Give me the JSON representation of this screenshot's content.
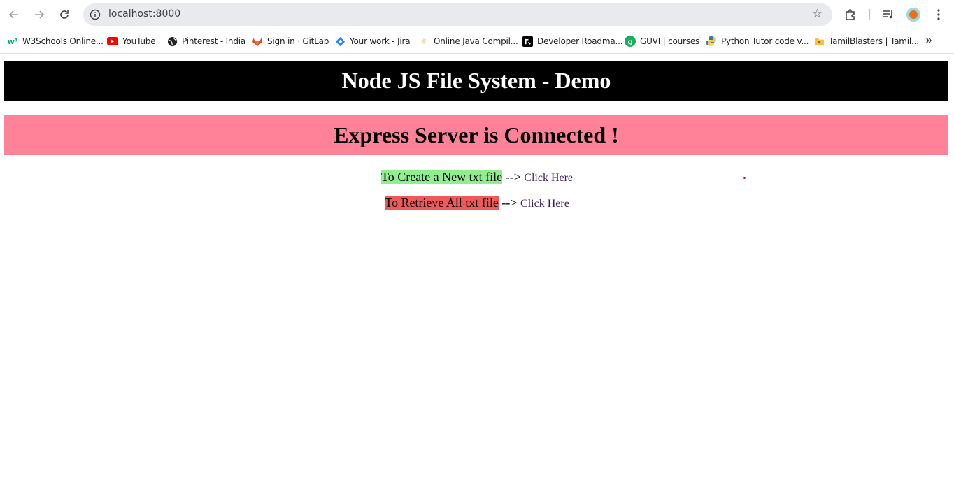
{
  "browser": {
    "url": "localhost:8000",
    "bookmarks": [
      {
        "label": "W3Schools Online...",
        "icon": "w3schools-icon"
      },
      {
        "label": "YouTube",
        "icon": "youtube-icon"
      },
      {
        "label": "Pinterest - India",
        "icon": "globe-icon"
      },
      {
        "label": "Sign in · GitLab",
        "icon": "gitlab-icon"
      },
      {
        "label": "Your work - Jira",
        "icon": "jira-icon"
      },
      {
        "label": "Online Java Compil...",
        "icon": "sun-icon"
      },
      {
        "label": "Developer Roadma...",
        "icon": "roadmap-icon"
      },
      {
        "label": "GUVI | courses",
        "icon": "guvi-icon"
      },
      {
        "label": "Python Tutor code v...",
        "icon": "python-icon"
      },
      {
        "label": "TamilBlasters | Tamil...",
        "icon": "folder-icon"
      }
    ],
    "more_bookmarks": "»"
  },
  "page": {
    "title": "Node JS File System - Demo",
    "status": "Express Server is Connected !",
    "actions": [
      {
        "label": "To Create a New txt file",
        "arrow": "-->",
        "link": "Click Here"
      },
      {
        "label": "To Retrieve All txt file",
        "arrow": "-->",
        "link": "Click Here"
      }
    ]
  },
  "colors": {
    "header_bg": "#000000",
    "status_bg": "#ff8298",
    "create_highlight": "#90ee90",
    "retrieve_highlight": "#f05959"
  }
}
